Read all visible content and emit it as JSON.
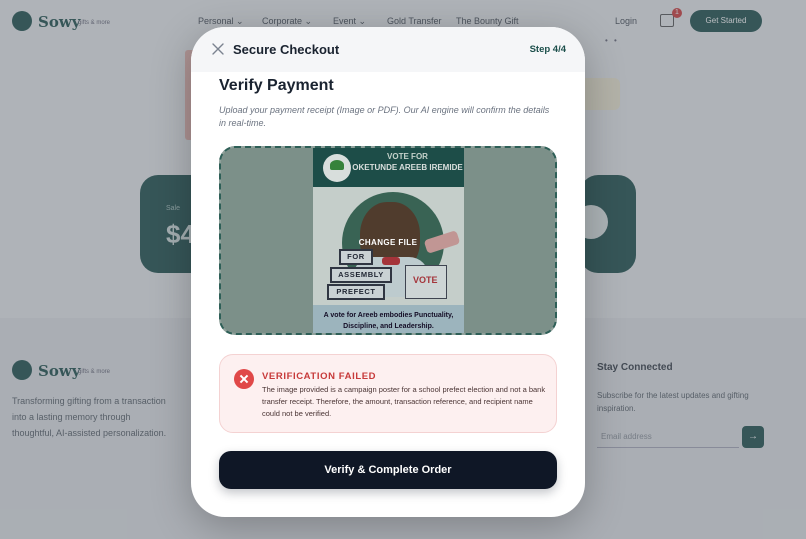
{
  "background": {
    "logo": "Sowy",
    "logo_tag": "gifts & more",
    "nav": [
      "Personal ⌄",
      "Corporate ⌄",
      "Event ⌄",
      "Gold Transfer",
      "The Bounty Gift"
    ],
    "login": "Login",
    "cart_count": "1",
    "get_started": "Get Started",
    "card_left_label": "Sale",
    "card_left_value": "$4",
    "footer_logo": "Sowy",
    "footer_text": "Transforming gifting from a transaction into a lasting memory through thoughtful, AI-assisted personalization.",
    "stay_connected": "Stay Connected",
    "stay_sub": "Subscribe for the latest updates and gifting inspiration.",
    "email_placeholder": "Email address",
    "email_button": "→"
  },
  "modal": {
    "title": "Secure Checkout",
    "step": "Step 4/4",
    "close_icon": "close-icon"
  },
  "verify": {
    "title": "Verify Payment",
    "description": "Upload your payment receipt (Image or PDF). Our AI engine will confirm the details in real-time."
  },
  "upload": {
    "change_file": "CHANGE FILE",
    "poster": {
      "header_line1": "VOTE FOR",
      "header_line2": "OKETUNDE AREEB IREMIDE",
      "sign1": "FOR",
      "sign2": "ASSEMBLY",
      "sign3": "PREFECT",
      "ballot": "VOTE",
      "footer": "A vote for Areeb embodies Punctuality, Discipline, and Leadership."
    }
  },
  "error": {
    "title": "VERIFICATION FAILED",
    "message": "The image provided is a campaign poster for a school prefect election and not a bank transfer receipt. Therefore, the amount, transaction reference, and recipient name could not be verified.",
    "icon": "error-x-icon"
  },
  "action": {
    "submit_label": "Verify & Complete Order"
  },
  "colors": {
    "brand": "#1c4f4b",
    "error": "#c73a3a",
    "primary_button": "#0f1726"
  }
}
